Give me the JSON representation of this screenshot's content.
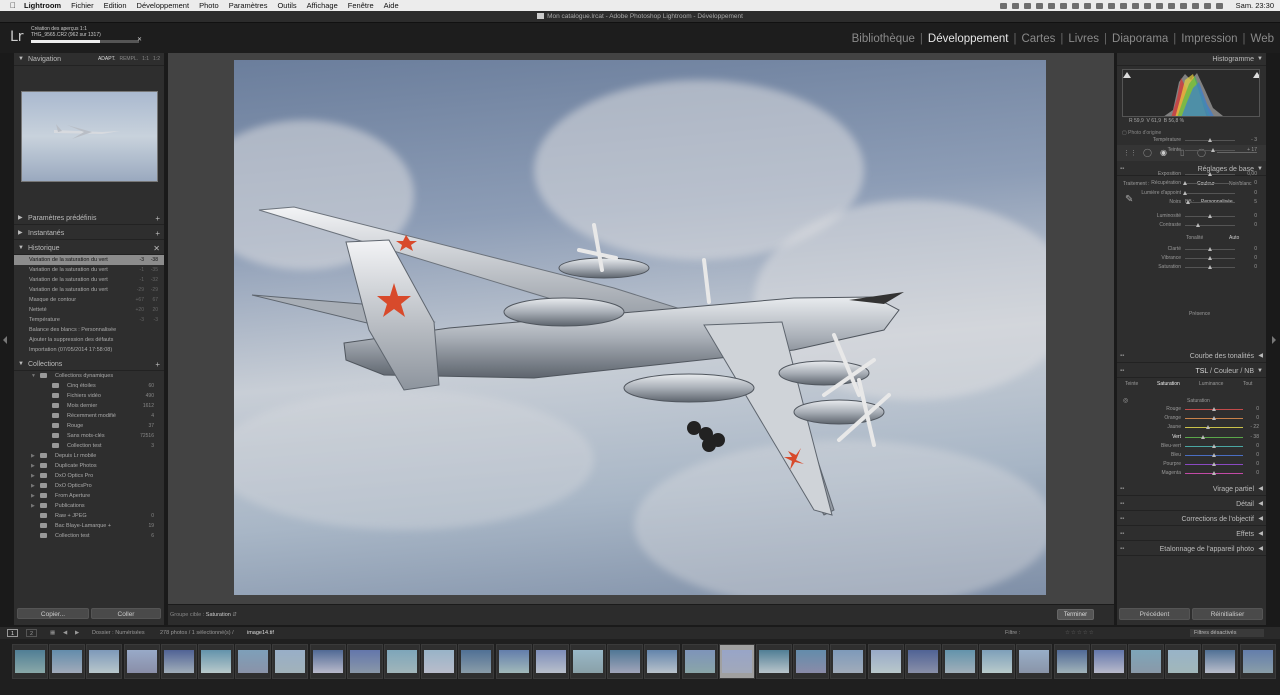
{
  "menubar": {
    "app": "Lightroom",
    "items": [
      "Fichier",
      "Edition",
      "Développement",
      "Photo",
      "Paramètres",
      "Outils",
      "Affichage",
      "Fenêtre",
      "Aide"
    ],
    "clock": "Sam. 23:30"
  },
  "window": {
    "title": "Mon catalogue.lrcat - Adobe Photoshop Lightroom - Développement"
  },
  "identity": {
    "logo": "Lr",
    "progress_title": "Création des aperçus 1:1",
    "progress_sub": "THG_9565.CR2 (962 sur 1317)",
    "progress_fraction": 0.64
  },
  "modules": [
    "Bibliothèque",
    "Développement",
    "Cartes",
    "Livres",
    "Diaporama",
    "Impression",
    "Web"
  ],
  "active_module": "Développement",
  "left_panel": {
    "navigator": {
      "title": "Navigation",
      "modes": [
        "ADAPT.",
        "REMPL.",
        "1:1",
        "1:2"
      ]
    },
    "presets": {
      "title": "Paramètres prédéfinis"
    },
    "snapshots": {
      "title": "Instantanés"
    },
    "history": {
      "title": "Historique",
      "items": [
        {
          "label": "Variation de la saturation du vert",
          "a": "-3",
          "b": "-38",
          "selected": true
        },
        {
          "label": "Variation de la saturation du vert",
          "a": "-1",
          "b": "-35",
          "selected": false
        },
        {
          "label": "Variation de la saturation du vert",
          "a": "-1",
          "b": "-32",
          "selected": false
        },
        {
          "label": "Variation de la saturation du vert",
          "a": "-29",
          "b": "-29",
          "selected": false
        },
        {
          "label": "Masque de contour",
          "a": "+67",
          "b": "67",
          "selected": false
        },
        {
          "label": "Netteté",
          "a": "+20",
          "b": "20",
          "selected": false
        },
        {
          "label": "Température",
          "a": "-3",
          "b": "-3",
          "selected": false
        },
        {
          "label": "Balance des blancs : Personnalisée",
          "a": "",
          "b": "",
          "selected": false
        },
        {
          "label": "Ajouter la suppression des défauts",
          "a": "",
          "b": "",
          "selected": false
        },
        {
          "label": "Importation (07/05/2014 17:58:08)",
          "a": "",
          "b": "",
          "selected": false
        }
      ]
    },
    "collections": {
      "title": "Collections",
      "items": [
        {
          "label": "Collections dynamiques",
          "count": "",
          "level": 1,
          "arrow": "▼"
        },
        {
          "label": "Cinq étoiles",
          "count": "60",
          "level": 2,
          "arrow": ""
        },
        {
          "label": "Fichiers vidéo",
          "count": "490",
          "level": 2,
          "arrow": ""
        },
        {
          "label": "Mois dernier",
          "count": "1612",
          "level": 2,
          "arrow": ""
        },
        {
          "label": "Récemment modifié",
          "count": "4",
          "level": 2,
          "arrow": ""
        },
        {
          "label": "Rouge",
          "count": "37",
          "level": 2,
          "arrow": ""
        },
        {
          "label": "Sans mots-clés",
          "count": "72516",
          "level": 2,
          "arrow": ""
        },
        {
          "label": "Collection test",
          "count": "3",
          "level": 2,
          "arrow": ""
        },
        {
          "label": "Depuis Lr mobile",
          "count": "",
          "level": 1,
          "arrow": "▶"
        },
        {
          "label": "Duplicate Photos",
          "count": "",
          "level": 1,
          "arrow": "▶"
        },
        {
          "label": "DxO Optics Pro",
          "count": "",
          "level": 1,
          "arrow": "▶"
        },
        {
          "label": "DxO OpticsPro",
          "count": "",
          "level": 1,
          "arrow": "▶"
        },
        {
          "label": "From Aperture",
          "count": "",
          "level": 1,
          "arrow": "▶"
        },
        {
          "label": "Publications",
          "count": "",
          "level": 1,
          "arrow": "▶"
        },
        {
          "label": "Raw + JPEG",
          "count": "0",
          "level": 1,
          "arrow": ""
        },
        {
          "label": "Bac Blaye-Lamarque +",
          "count": "19",
          "level": 1,
          "arrow": ""
        },
        {
          "label": "Collection test",
          "count": "6",
          "level": 1,
          "arrow": ""
        }
      ]
    },
    "copy_btn": "Copier...",
    "paste_btn": "Coller"
  },
  "toolbar": {
    "target_label": "Groupe cible :",
    "target_value": "Saturation",
    "done_btn": "Terminer"
  },
  "right_panel": {
    "histogram": {
      "title": "Histogramme",
      "r_label": "R",
      "r": "59,9",
      "v_label": "V",
      "v": "61,9",
      "b_label": "B",
      "b": "56,8",
      "unit": "%",
      "orig": "Photo d'origine"
    },
    "basic": {
      "title": "Réglages de base",
      "treatment_label": "Traitement :",
      "color": "Couleur",
      "bw": "Noir/blanc",
      "wb_label": "BB :",
      "wb_value": "Personnalisée",
      "tonality": "Tonalité",
      "auto": "Auto",
      "presence": "Présence",
      "sliders": [
        {
          "label": "Température",
          "value": "- 3",
          "pos": 0.5
        },
        {
          "label": "Teinte",
          "value": "+ 17",
          "pos": 0.55
        },
        {
          "label": "Exposition",
          "value": "0,00",
          "pos": 0.5
        },
        {
          "label": "Récupération",
          "value": "0",
          "pos": 0.0
        },
        {
          "label": "Lumière d'appoint",
          "value": "0",
          "pos": 0.0
        },
        {
          "label": "Noirs",
          "value": "5",
          "pos": 0.05
        },
        {
          "label": "Luminosité",
          "value": "0",
          "pos": 0.5
        },
        {
          "label": "Contraste",
          "value": "0",
          "pos": 0.25
        },
        {
          "label": "Clarté",
          "value": "0",
          "pos": 0.5
        },
        {
          "label": "Vibrance",
          "value": "0",
          "pos": 0.5
        },
        {
          "label": "Saturation",
          "value": "0",
          "pos": 0.5
        }
      ]
    },
    "tone_curve": {
      "title": "Courbe des tonalités"
    },
    "hsl": {
      "title_a": "TSL",
      "title_b": "Couleur",
      "title_c": "NB",
      "tabs": [
        "Teinte",
        "Saturation",
        "Luminance",
        "Tout"
      ],
      "active_tab": "Saturation",
      "group": "Saturation",
      "sliders": [
        {
          "label": "Rouge",
          "value": "0",
          "pos": 0.5,
          "color": "#c24a4a"
        },
        {
          "label": "Orange",
          "value": "0",
          "pos": 0.5,
          "color": "#c9824a"
        },
        {
          "label": "Jaune",
          "value": "- 22",
          "pos": 0.39,
          "color": "#c9c24a"
        },
        {
          "label": "Vert",
          "value": "- 38",
          "pos": 0.31,
          "color": "#5aa64a"
        },
        {
          "label": "Bleu-vert",
          "value": "0",
          "pos": 0.5,
          "color": "#4aa6a2"
        },
        {
          "label": "Bleu",
          "value": "0",
          "pos": 0.5,
          "color": "#4a6ec2"
        },
        {
          "label": "Pourpre",
          "value": "0",
          "pos": 0.5,
          "color": "#8a4ac2"
        },
        {
          "label": "Magenta",
          "value": "0",
          "pos": 0.5,
          "color": "#c24aa6"
        }
      ]
    },
    "split_toning": {
      "title": "Virage partiel"
    },
    "detail": {
      "title": "Détail"
    },
    "lens": {
      "title": "Corrections de l'objectif"
    },
    "effects": {
      "title": "Effets"
    },
    "camera": {
      "title": "Etalonnage de l'appareil photo"
    },
    "prev_btn": "Précédent",
    "reset_btn": "Réinitialiser"
  },
  "filmstrip_bar": {
    "page1": "1",
    "page2": "2",
    "folder": "Dossier : Numérisées",
    "count": "278 photos / 1 sélectionné(s) /",
    "file": "image14.tif",
    "filter_label": "Filtre :",
    "filter_value": "Filtres désactivés"
  },
  "filmstrip": {
    "thumb_count": 34,
    "selected_index": 19
  }
}
